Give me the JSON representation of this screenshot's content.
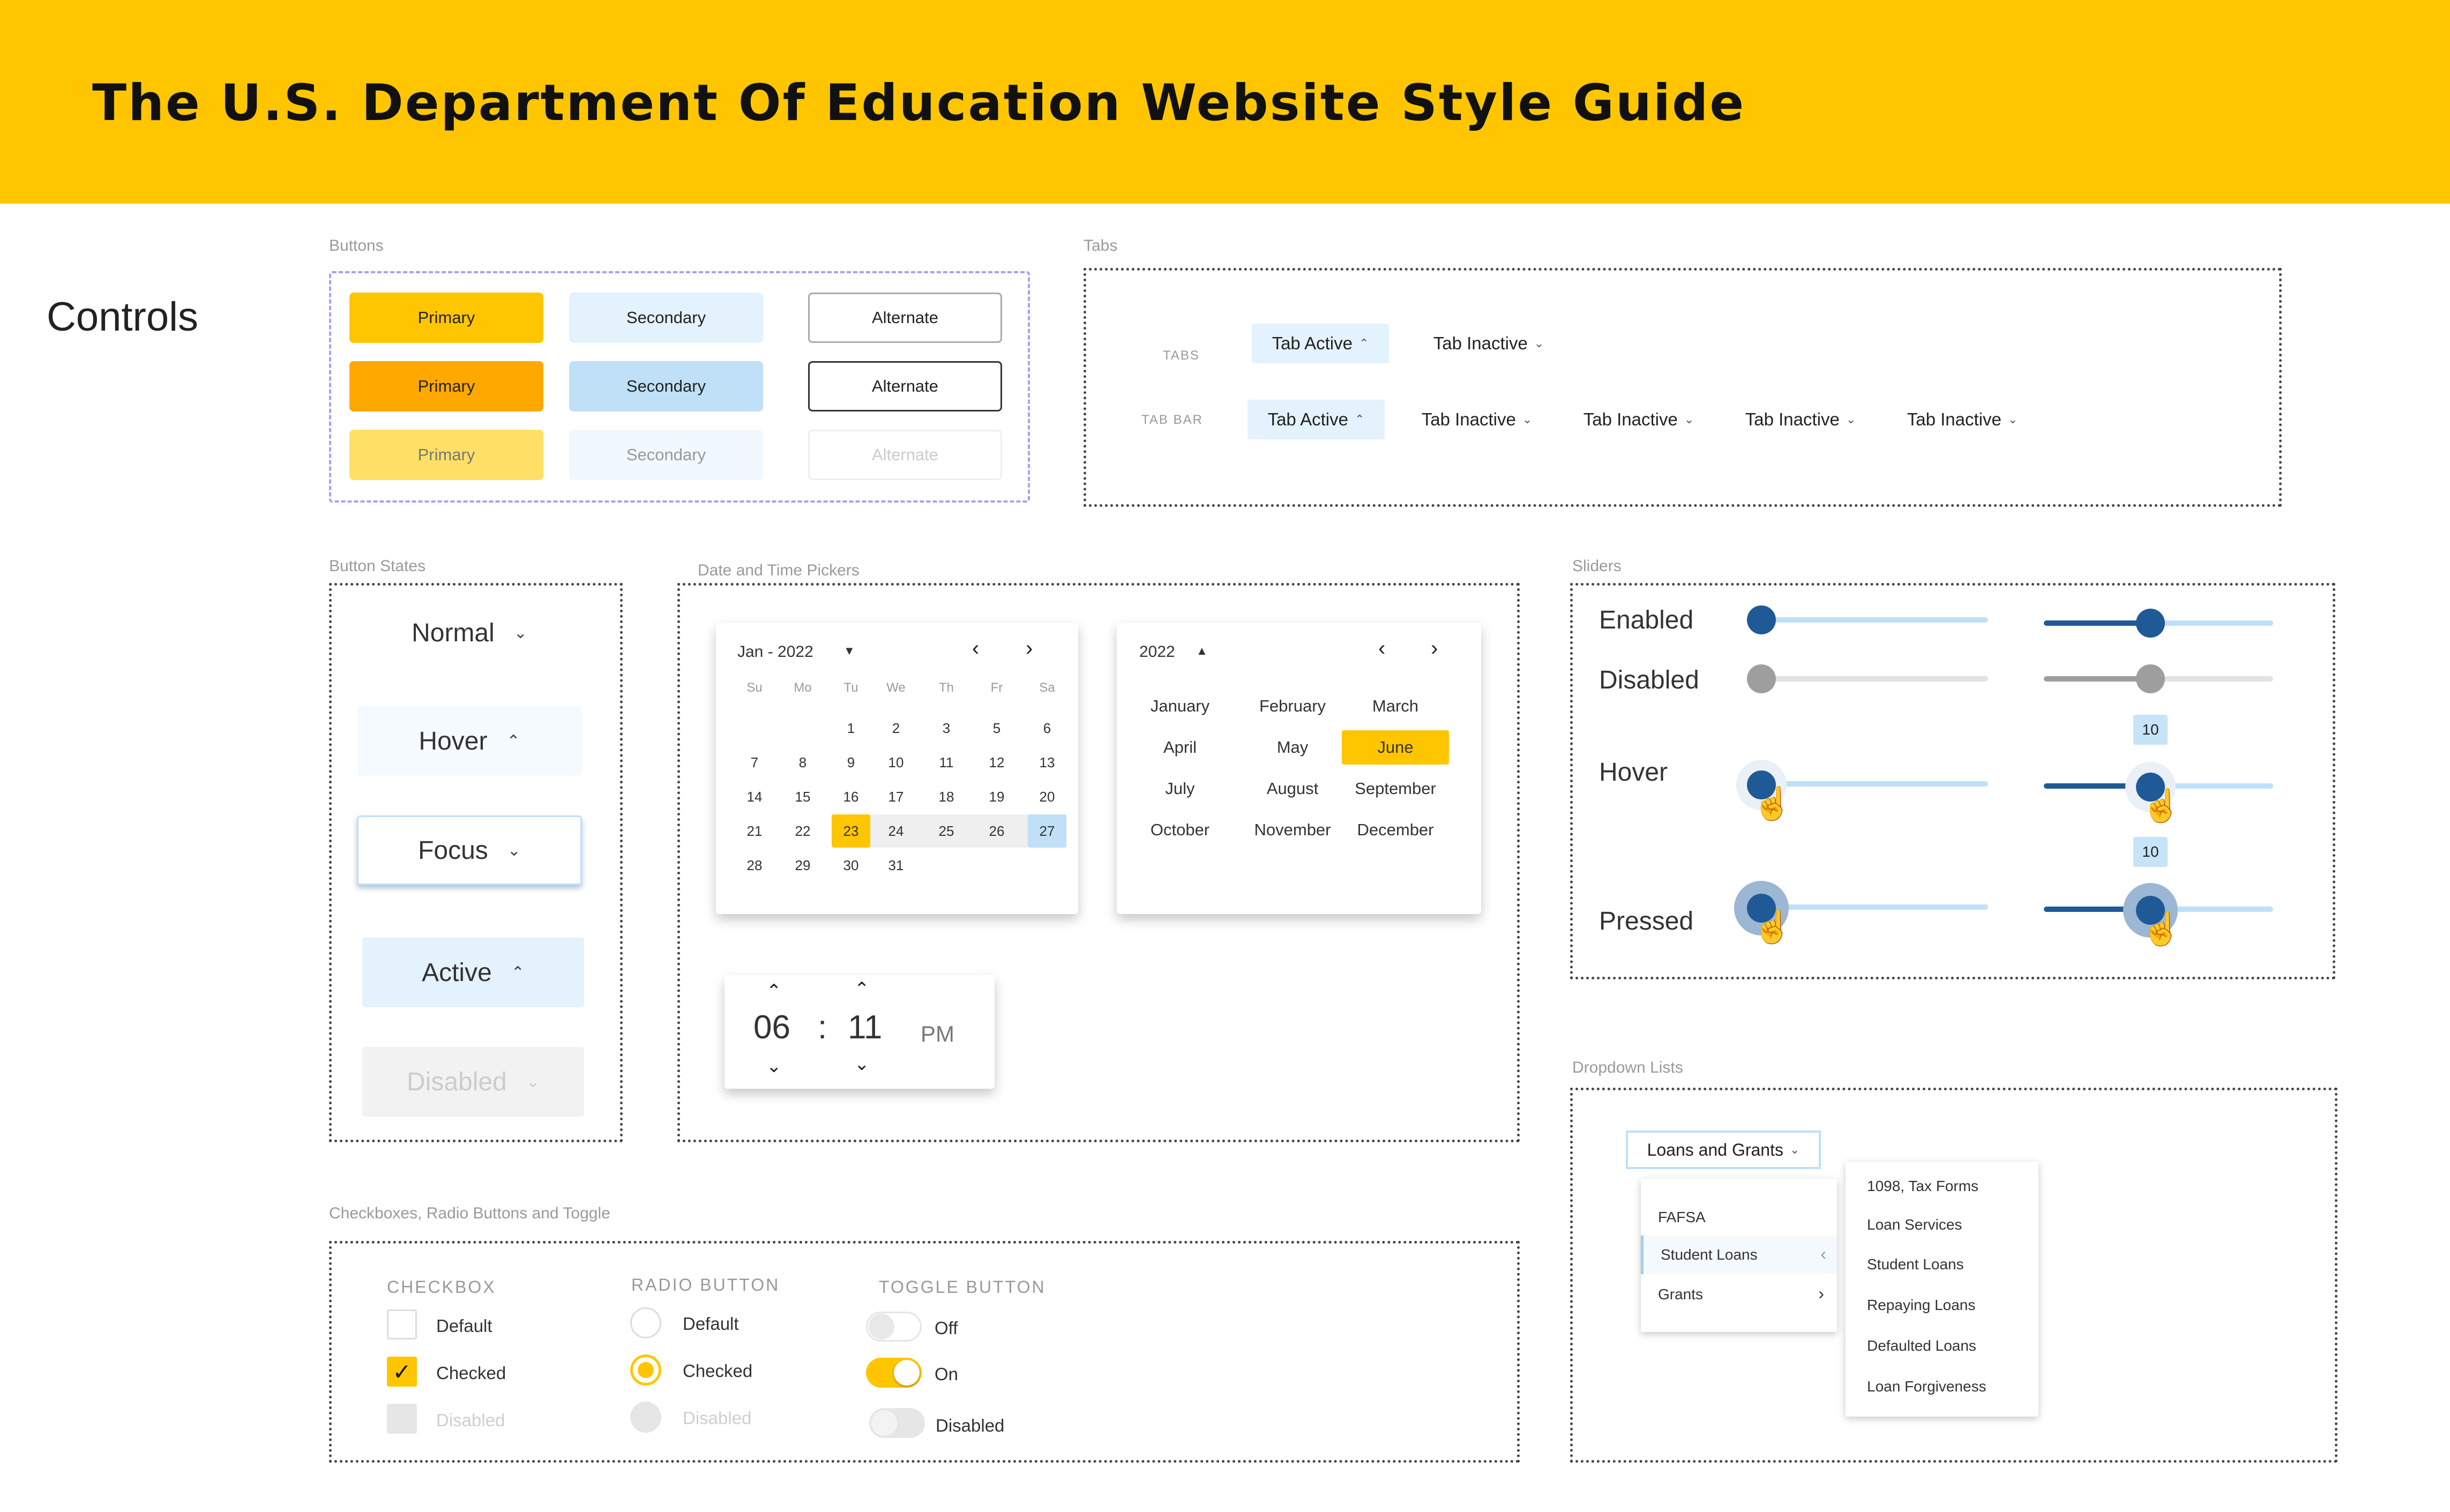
{
  "header": {
    "title": "The U.S. Department Of Education Website Style Guide"
  },
  "controls_title": "Controls",
  "buttons": {
    "label": "Buttons",
    "primary": "Primary",
    "secondary": "Secondary",
    "alternate": "Alternate"
  },
  "tabs": {
    "label": "Tabs",
    "tabs_row_label": "TABS",
    "tabbar_row_label": "TAB BAR",
    "active": "Tab Active",
    "inactive": "Tab Inactive"
  },
  "button_states": {
    "label": "Button States",
    "normal": "Normal",
    "hover": "Hover",
    "focus": "Focus",
    "active": "Active",
    "disabled": "Disabled"
  },
  "pickers": {
    "label": "Date and Time Pickers",
    "calendar": {
      "month_year": "Jan - 2022",
      "weekdays": [
        "Su",
        "Mo",
        "Tu",
        "We",
        "Th",
        "Fr",
        "Sa"
      ],
      "selected_day": "23",
      "today_day": "27",
      "weeks": [
        [
          "",
          "",
          "1",
          "2",
          "3",
          "5",
          "6"
        ],
        [
          "7",
          "8",
          "9",
          "10",
          "11",
          "12",
          "13"
        ],
        [
          "14",
          "15",
          "16",
          "17",
          "18",
          "19",
          "20"
        ],
        [
          "21",
          "22",
          "23",
          "24",
          "25",
          "26",
          "27"
        ],
        [
          "28",
          "29",
          "30",
          "31",
          "",
          "",
          ""
        ]
      ]
    },
    "month_picker": {
      "year": "2022",
      "months": [
        "January",
        "February",
        "March",
        "April",
        "May",
        "June",
        "July",
        "August",
        "September",
        "October",
        "November",
        "December"
      ],
      "selected": "June"
    },
    "time": {
      "hours": "06",
      "separator": ":",
      "minutes": "11",
      "period": "PM"
    }
  },
  "sliders": {
    "label": "Sliders",
    "enabled": "Enabled",
    "disabled": "Disabled",
    "hover": "Hover",
    "pressed": "Pressed",
    "tooltip_value": "10"
  },
  "dropdowns": {
    "label": "Dropdown Lists",
    "button": "Loans and Grants",
    "menu": [
      "FAFSA",
      "Student Loans",
      "Grants"
    ],
    "submenu": [
      "1098, Tax Forms",
      "Loan Services",
      "Student Loans",
      "Repaying Loans",
      "Defaulted Loans",
      "Loan Forgiveness"
    ]
  },
  "toggles": {
    "label": "Checkboxes, Radio Buttons and Toggle",
    "checkbox_title": "CHECKBOX",
    "radio_title": "RADIO BUTTON",
    "toggle_title": "TOGGLE BUTTON",
    "default": "Default",
    "checked": "Checked",
    "disabled": "Disabled",
    "off": "Off",
    "on": "On"
  },
  "colors": {
    "brand_yellow": "#FFC600",
    "primary_blue": "#1F5A96",
    "light_blue": "#BFE0F7",
    "tab_active_bg": "#E3F2FD"
  }
}
